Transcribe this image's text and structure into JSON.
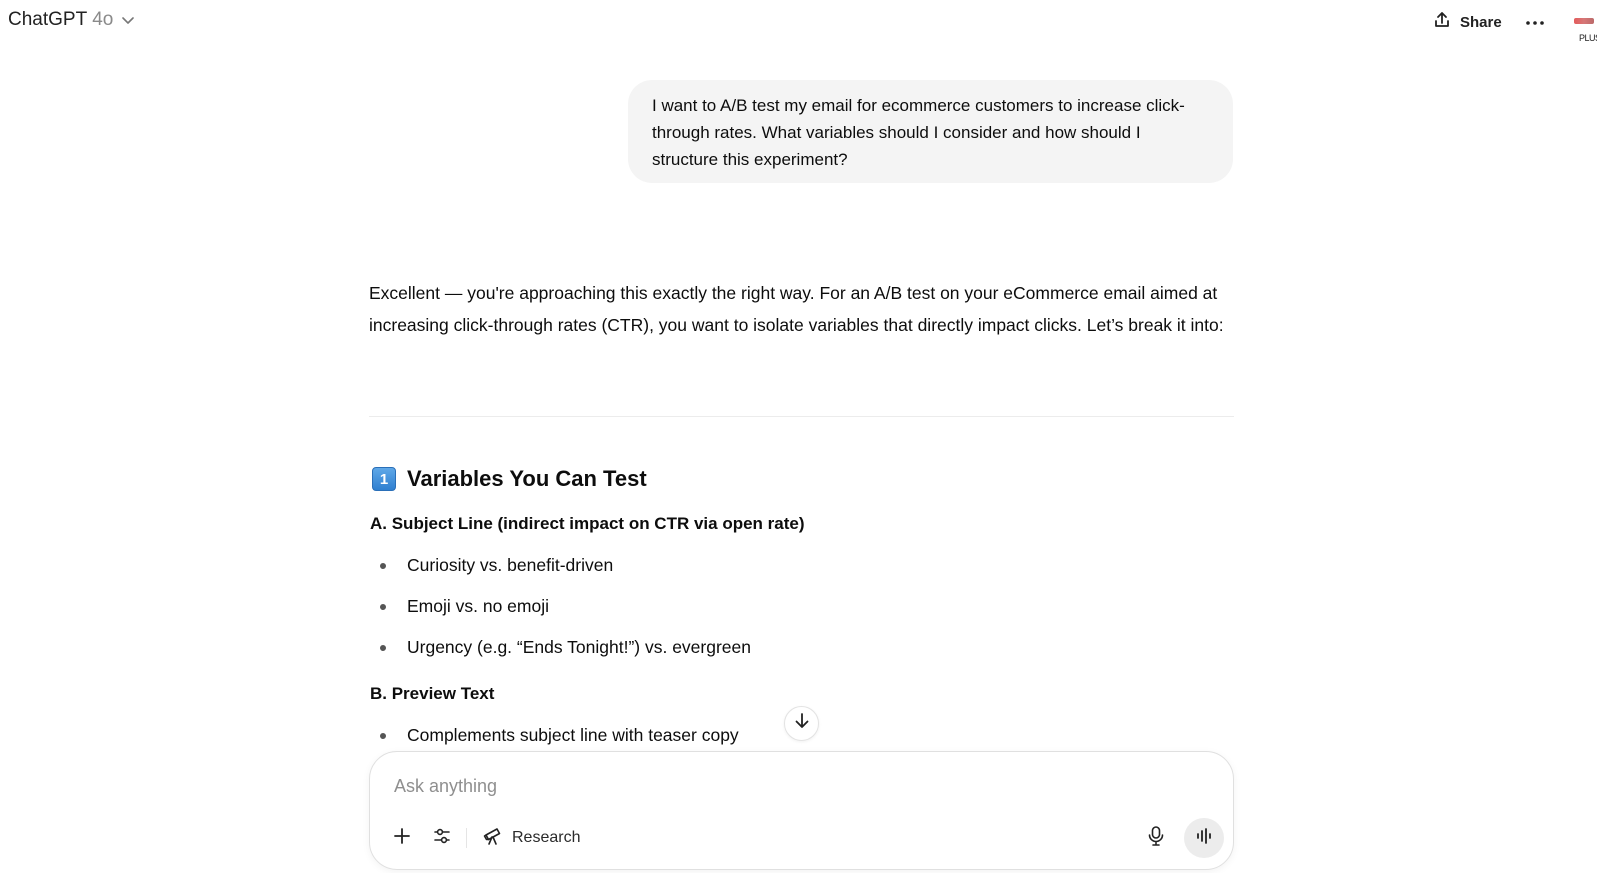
{
  "header": {
    "app_name": "ChatGPT",
    "model_version": "4o",
    "share_label": "Share",
    "avatar_label": "PLUS"
  },
  "conversation": {
    "user_message": "I want to A/B test my email for ecommerce customers to increase click-through rates. What variables should I consider and how should I structure this experiment?",
    "assistant": {
      "intro": "Excellent — you're approaching this exactly the right way. For an A/B test on your eCommerce email aimed at increasing click-through rates (CTR), you want to isolate variables that directly impact clicks. Let’s break it into:",
      "section_number": "1",
      "section_title": "Variables You Can Test",
      "subsection_a": {
        "title": "A. Subject Line (indirect impact on CTR via open rate)",
        "bullets": [
          "Curiosity vs. benefit-driven",
          "Emoji vs. no emoji",
          "Urgency (e.g. “Ends Tonight!”) vs. evergreen"
        ]
      },
      "subsection_b": {
        "title": "B. Preview Text",
        "bullets": [
          "Complements subject line with teaser copy"
        ]
      }
    }
  },
  "composer": {
    "placeholder": "Ask anything",
    "research_label": "Research"
  },
  "icons": {
    "model_dropdown": "chevron-down-icon",
    "share": "share-icon",
    "more": "more-icon",
    "scroll_down": "arrow-down-icon",
    "add": "plus-icon",
    "tools": "sliders-icon",
    "research": "telescope-icon",
    "mic": "microphone-icon",
    "voice": "voice-waveform-icon"
  }
}
